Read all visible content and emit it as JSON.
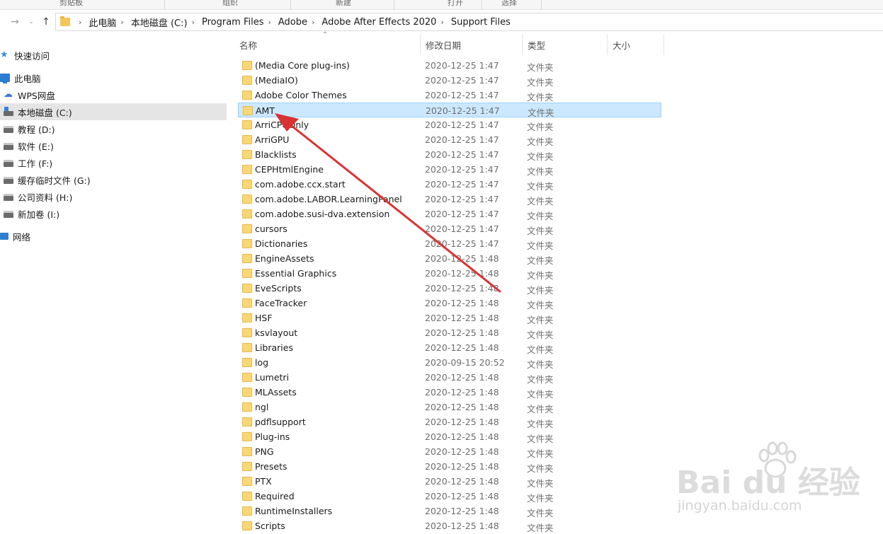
{
  "ribbon": {
    "groups": [
      "剪贴板",
      "组织",
      "新建",
      "打开",
      "选择"
    ]
  },
  "nav": {
    "back_icon": "arrow-left-icon",
    "forward_icon": "chevron-down-icon",
    "up_icon": "arrow-up-icon",
    "breadcrumb": [
      "此电脑",
      "本地磁盘 (C:)",
      "Program Files",
      "Adobe",
      "Adobe After Effects 2020",
      "Support Files"
    ]
  },
  "sidebar": {
    "items": [
      {
        "label": "快速访问",
        "icon": "star-icon"
      },
      {
        "label": "此电脑",
        "icon": "computer-icon"
      },
      {
        "label": "WPS网盘",
        "icon": "cloud-icon"
      },
      {
        "label": "本地磁盘 (C:)",
        "icon": "drive-icon"
      },
      {
        "label": "教程 (D:)",
        "icon": "drive-icon"
      },
      {
        "label": "软件 (E:)",
        "icon": "drive-icon"
      },
      {
        "label": "工作 (F:)",
        "icon": "drive-icon"
      },
      {
        "label": "缓存临时文件 (G:)",
        "icon": "drive-icon"
      },
      {
        "label": "公司资料 (H:)",
        "icon": "drive-icon"
      },
      {
        "label": "新加卷 (I:)",
        "icon": "drive-icon"
      },
      {
        "label": "网络",
        "icon": "network-icon"
      }
    ]
  },
  "columns": {
    "name": "名称",
    "date": "修改日期",
    "type": "类型",
    "size": "大小"
  },
  "files": [
    {
      "name": "(Media Core plug-ins)",
      "date": "2020-12-25 1:47",
      "type": "文件夹"
    },
    {
      "name": "(MediaIO)",
      "date": "2020-12-25 1:47",
      "type": "文件夹"
    },
    {
      "name": "Adobe Color Themes",
      "date": "2020-12-25 1:47",
      "type": "文件夹"
    },
    {
      "name": "AMT",
      "date": "2020-12-25 1:47",
      "type": "文件夹"
    },
    {
      "name": "ArriCPUOnly",
      "date": "2020-12-25 1:47",
      "type": "文件夹"
    },
    {
      "name": "ArriGPU",
      "date": "2020-12-25 1:47",
      "type": "文件夹"
    },
    {
      "name": "Blacklists",
      "date": "2020-12-25 1:47",
      "type": "文件夹"
    },
    {
      "name": "CEPHtmlEngine",
      "date": "2020-12-25 1:47",
      "type": "文件夹"
    },
    {
      "name": "com.adobe.ccx.start",
      "date": "2020-12-25 1:47",
      "type": "文件夹"
    },
    {
      "name": "com.adobe.LABOR.LearningPanel",
      "date": "2020-12-25 1:47",
      "type": "文件夹"
    },
    {
      "name": "com.adobe.susi-dva.extension",
      "date": "2020-12-25 1:47",
      "type": "文件夹"
    },
    {
      "name": "cursors",
      "date": "2020-12-25 1:47",
      "type": "文件夹"
    },
    {
      "name": "Dictionaries",
      "date": "2020-12-25 1:47",
      "type": "文件夹"
    },
    {
      "name": "EngineAssets",
      "date": "2020-12-25 1:48",
      "type": "文件夹"
    },
    {
      "name": "Essential Graphics",
      "date": "2020-12-25 1:48",
      "type": "文件夹"
    },
    {
      "name": "EveScripts",
      "date": "2020-12-25 1:48",
      "type": "文件夹"
    },
    {
      "name": "FaceTracker",
      "date": "2020-12-25 1:48",
      "type": "文件夹"
    },
    {
      "name": "HSF",
      "date": "2020-12-25 1:48",
      "type": "文件夹"
    },
    {
      "name": "ksvlayout",
      "date": "2020-12-25 1:48",
      "type": "文件夹"
    },
    {
      "name": "Libraries",
      "date": "2020-12-25 1:48",
      "type": "文件夹"
    },
    {
      "name": "log",
      "date": "2020-09-15 20:52",
      "type": "文件夹"
    },
    {
      "name": "Lumetri",
      "date": "2020-12-25 1:48",
      "type": "文件夹"
    },
    {
      "name": "MLAssets",
      "date": "2020-12-25 1:48",
      "type": "文件夹"
    },
    {
      "name": "ngl",
      "date": "2020-12-25 1:48",
      "type": "文件夹"
    },
    {
      "name": "pdflsupport",
      "date": "2020-12-25 1:48",
      "type": "文件夹"
    },
    {
      "name": "Plug-ins",
      "date": "2020-12-25 1:48",
      "type": "文件夹"
    },
    {
      "name": "PNG",
      "date": "2020-12-25 1:48",
      "type": "文件夹"
    },
    {
      "name": "Presets",
      "date": "2020-12-25 1:48",
      "type": "文件夹"
    },
    {
      "name": "PTX",
      "date": "2020-12-25 1:48",
      "type": "文件夹"
    },
    {
      "name": "Required",
      "date": "2020-12-25 1:48",
      "type": "文件夹"
    },
    {
      "name": "RuntimeInstallers",
      "date": "2020-12-25 1:48",
      "type": "文件夹"
    },
    {
      "name": "Scripts",
      "date": "2020-12-25 1:48",
      "type": "文件夹"
    }
  ],
  "selected_file": "AMT",
  "annotation": {
    "color": "#d93232",
    "icon": "red-arrow-annotation"
  },
  "watermark": {
    "brand": "Bai du 经验",
    "site": "jingyan.baidu.com"
  },
  "colors": {
    "selection": "#cce8ff",
    "selection_border": "#99d1ff",
    "folder": "#f8d775",
    "sidebar_selected": "#e5e5e5"
  }
}
